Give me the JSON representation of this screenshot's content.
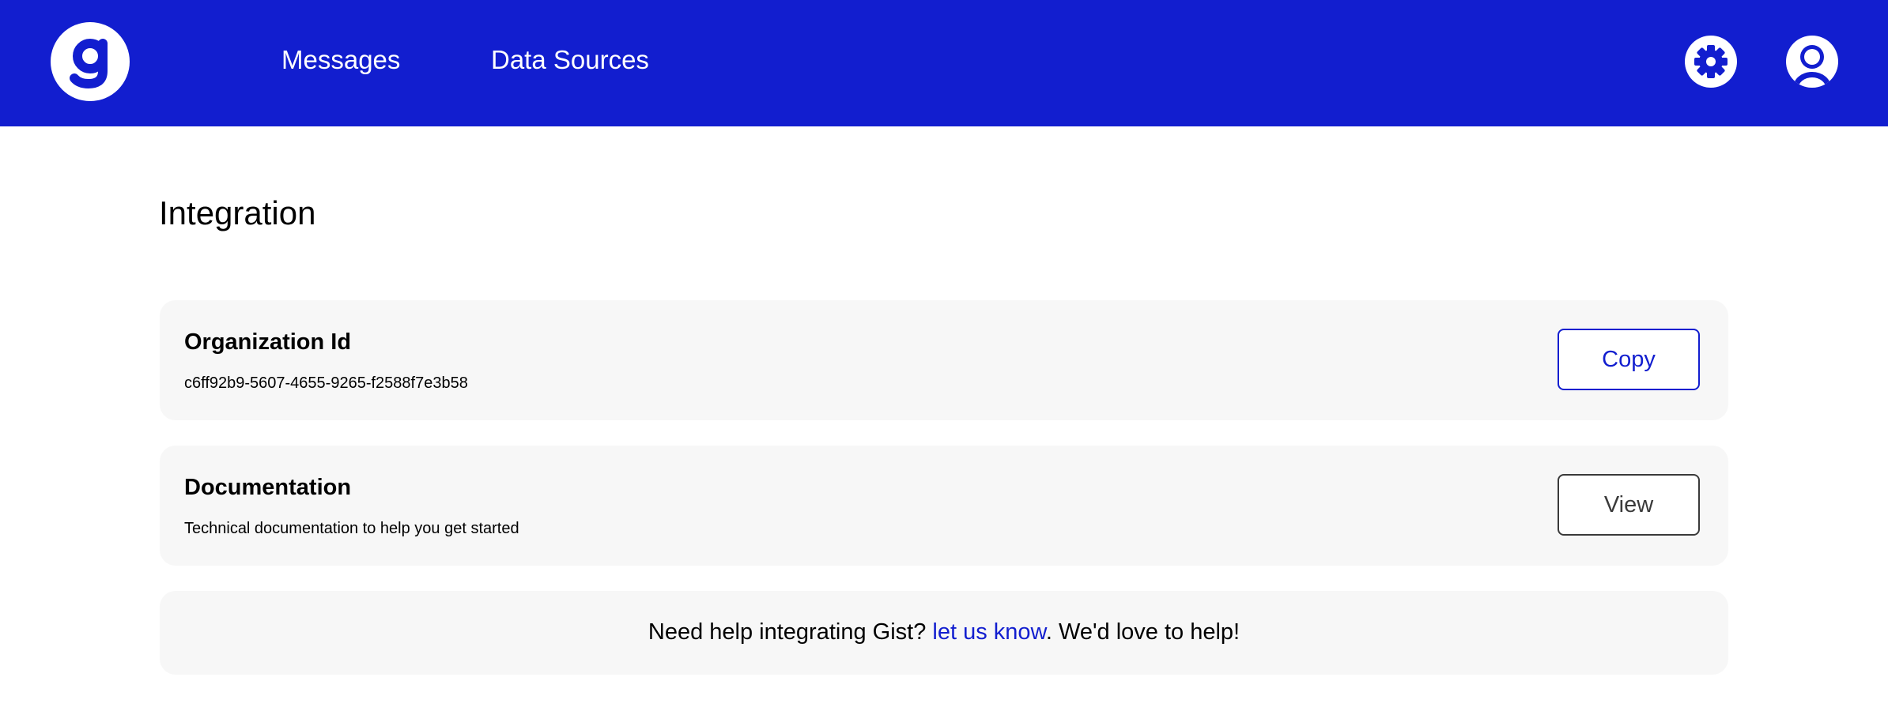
{
  "header": {
    "logo_icon": "gist-logo-icon",
    "nav": {
      "messages_label": "Messages",
      "data_sources_label": "Data Sources"
    },
    "settings_icon": "gear-icon",
    "account_icon": "user-circle-icon"
  },
  "main": {
    "title": "Integration",
    "organization": {
      "title": "Organization Id",
      "value": "c6ff92b9-5607-4655-9265-f2588f7e3b58",
      "button_label": "Copy"
    },
    "documentation": {
      "title": "Documentation",
      "description": "Technical documentation to help you get started",
      "button_label": "View"
    },
    "help": {
      "prefix": "Need help integrating Gist? ",
      "link_label": "let us know",
      "suffix": ". We'd love to help!"
    }
  },
  "colors": {
    "brand_blue": "#121ecf",
    "card_background": "#f7f7f7",
    "header_text": "#ffffff"
  }
}
